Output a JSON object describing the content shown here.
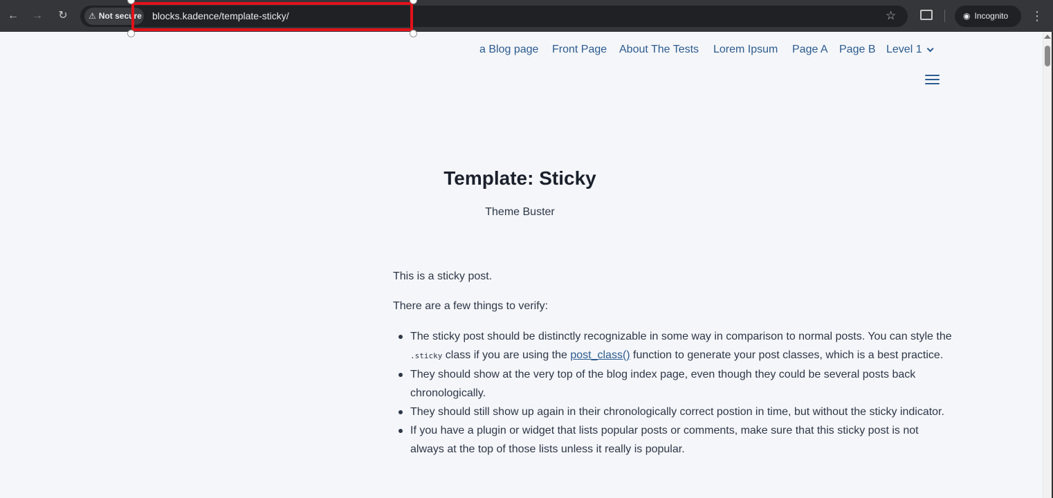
{
  "browser": {
    "security_label": "Not secure",
    "url": "blocks.kadence/template-sticky/",
    "incognito_label": "Incognito"
  },
  "nav": {
    "items": [
      "a Blog page",
      "Front Page",
      "About The Tests",
      "Lorem Ipsum",
      "Page A",
      "Page B",
      "Level 1"
    ]
  },
  "page": {
    "title": "Template: Sticky",
    "subtitle": "Theme Buster",
    "intro": "This is a sticky post.",
    "lead": "There are a few things to verify:",
    "bullets": [
      {
        "text_before": "The sticky post should be distinctly recognizable in some way in comparison to normal posts. You can style the ",
        "code": ".sticky",
        "text_mid": " class if you are using the ",
        "link": "post_class()",
        "text_after": " function to generate your post classes, which is a best practice."
      },
      {
        "text": "They should show at the very top of the blog index page, even though they could be several posts back chronologically."
      },
      {
        "text": "They should still show up again in their chronologically correct postion in time, but without the sticky indicator."
      },
      {
        "text": "If you have a plugin or widget that lists popular posts or comments, make sure that this sticky post is not always at the top of those lists unless it really is popular."
      }
    ]
  },
  "colors": {
    "highlight": "#e2121a",
    "link": "#2b5b8f",
    "background": "#f5f6f9"
  }
}
